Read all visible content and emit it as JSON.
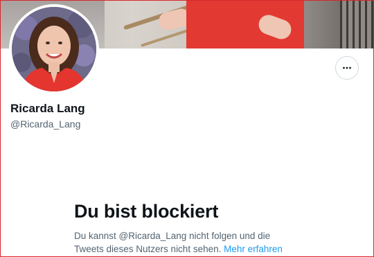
{
  "profile": {
    "display_name": "Ricarda Lang",
    "handle": "@Ricarda_Lang"
  },
  "actions": {
    "more_icon": "more-horizontal-icon"
  },
  "blocked": {
    "title": "Du bist blockiert",
    "text_line1": "Du kannst @Ricarda_Lang nicht folgen und die",
    "text_line2": "Tweets dieses Nutzers nicht sehen.",
    "learn_more": "Mehr erfahren"
  },
  "colors": {
    "accent_link": "#1d9bf0",
    "frame_border": "#d9262b",
    "secondary_text": "#536471",
    "primary_text": "#0f1419"
  }
}
